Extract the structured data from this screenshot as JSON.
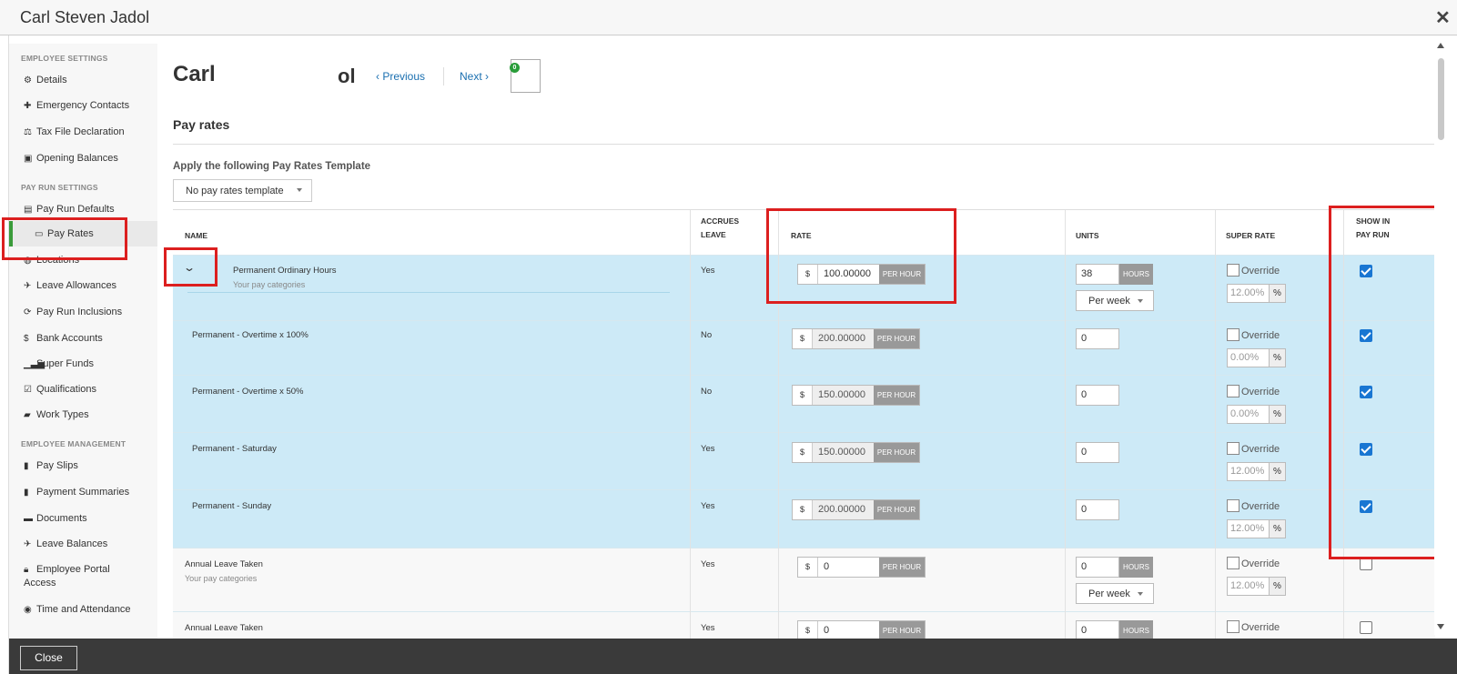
{
  "window": {
    "title": "Carl Steven Jadol",
    "close_glyph": "✕"
  },
  "sidebar": {
    "sections": [
      {
        "label": "EMPLOYEE SETTINGS",
        "items": [
          {
            "label": "Details",
            "icon": "gear-icon"
          },
          {
            "label": "Emergency Contacts",
            "icon": "plus-icon"
          },
          {
            "label": "Tax File Declaration",
            "icon": "scale-icon"
          },
          {
            "label": "Opening Balances",
            "icon": "wallet-icon"
          }
        ]
      },
      {
        "label": "PAY RUN SETTINGS",
        "items": [
          {
            "label": "Pay Run Defaults",
            "icon": "clipboard-icon"
          },
          {
            "label": "Pay Rates",
            "icon": "money-icon",
            "active": true
          },
          {
            "label": "Locations",
            "icon": "globe-icon"
          },
          {
            "label": "Leave Allowances",
            "icon": "plane-icon"
          },
          {
            "label": "Pay Run Inclusions",
            "icon": "refresh-icon"
          },
          {
            "label": "Bank Accounts",
            "icon": "dollar-icon"
          },
          {
            "label": "Super Funds",
            "icon": "bars-icon"
          },
          {
            "label": "Qualifications",
            "icon": "check-square-icon"
          },
          {
            "label": "Work Types",
            "icon": "book-icon"
          }
        ]
      },
      {
        "label": "EMPLOYEE MANAGEMENT",
        "items": [
          {
            "label": "Pay Slips",
            "icon": "file-icon"
          },
          {
            "label": "Payment Summaries",
            "icon": "file-icon"
          },
          {
            "label": "Documents",
            "icon": "folder-icon"
          },
          {
            "label": "Leave Balances",
            "icon": "plane-icon"
          },
          {
            "label": "Employee Portal Access",
            "icon": "lock-icon"
          },
          {
            "label": "Time and Attendance",
            "icon": "person-icon"
          }
        ]
      }
    ]
  },
  "header": {
    "name_first": "Carl",
    "name_last": "ol",
    "previous": "Previous",
    "next": "Next",
    "notification_count": "0"
  },
  "section": {
    "title": "Pay rates",
    "apply_label": "Apply the following Pay Rates Template",
    "template_select": "No pay rates template"
  },
  "table": {
    "headers": {
      "name": "NAME",
      "accrues_1": "ACCRUES",
      "accrues_2": "LEAVE",
      "rate": "RATE",
      "units": "UNITS",
      "super": "SUPER RATE",
      "show_1": "SHOW IN",
      "show_2": "PAY RUN"
    },
    "rows": [
      {
        "name": "Permanent Ordinary Hours",
        "sub": "Your pay categories",
        "accrues": "Yes",
        "currency": "$",
        "rate": "100.00000",
        "rate_unit": "PER HOUR",
        "units": "38",
        "units_unit": "HOURS",
        "period": "Per week",
        "override": "Override",
        "super": "12.00%",
        "pct": "%",
        "show": true
      },
      {
        "name": "Permanent - Overtime x 100%",
        "accrues": "No",
        "currency": "$",
        "rate": "200.00000",
        "rate_unit": "PER HOUR",
        "units": "0",
        "override": "Override",
        "super": "0.00%",
        "pct": "%",
        "show": true
      },
      {
        "name": "Permanent - Overtime x 50%",
        "accrues": "No",
        "currency": "$",
        "rate": "150.00000",
        "rate_unit": "PER HOUR",
        "units": "0",
        "override": "Override",
        "super": "0.00%",
        "pct": "%",
        "show": true
      },
      {
        "name": "Permanent - Saturday",
        "accrues": "Yes",
        "currency": "$",
        "rate": "150.00000",
        "rate_unit": "PER HOUR",
        "units": "0",
        "override": "Override",
        "super": "12.00%",
        "pct": "%",
        "show": true
      },
      {
        "name": "Permanent - Sunday",
        "accrues": "Yes",
        "currency": "$",
        "rate": "200.00000",
        "rate_unit": "PER HOUR",
        "units": "0",
        "override": "Override",
        "super": "12.00%",
        "pct": "%",
        "show": true
      },
      {
        "name": "Annual Leave Taken",
        "sub": "Your pay categories",
        "accrues": "Yes",
        "currency": "$",
        "rate": "0",
        "rate_unit": "PER HOUR",
        "units": "0",
        "units_unit": "HOURS",
        "period": "Per week",
        "override": "Override",
        "super": "12.00%",
        "pct": "%",
        "show": false
      },
      {
        "name": "Annual Leave Taken",
        "accrues": "Yes",
        "currency": "$",
        "rate": "0",
        "rate_unit": "PER HOUR",
        "units": "0",
        "units_unit": "HOURS",
        "override": "Override",
        "show": false
      }
    ]
  },
  "footer": {
    "close": "Close"
  },
  "colors": {
    "highlight": "#dc1f1f",
    "row_blue": "#cdeaf7",
    "check": "#1976d2",
    "active_bar": "#3a9b3a"
  }
}
